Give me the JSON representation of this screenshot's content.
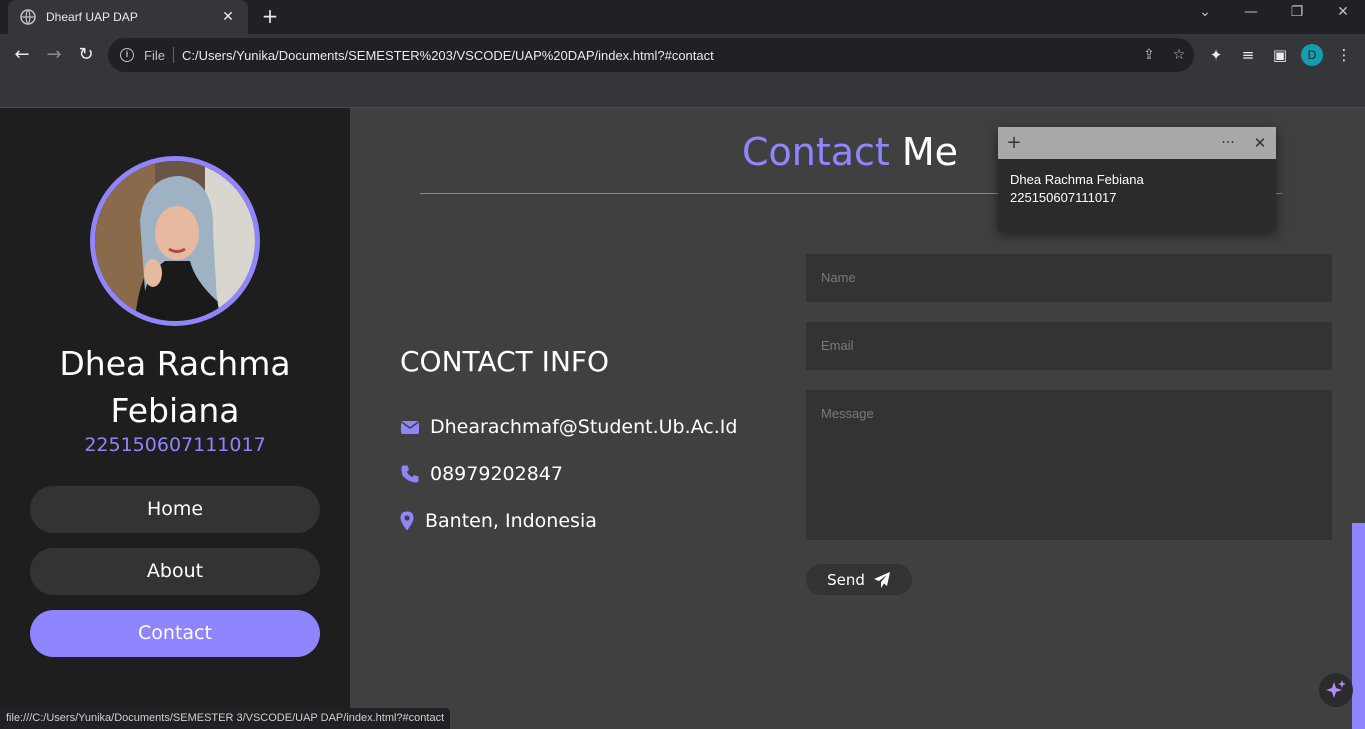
{
  "browser": {
    "tab_title": "Dhearf UAP DAP",
    "new_tab": "+",
    "omnibox_file_label": "File",
    "url": "C:/Users/Yunika/Documents/SEMESTER%203/VSCODE/UAP%20DAP/index.html?#contact",
    "profile_initial": "D",
    "status_url": "file:///C:/Users/Yunika/Documents/SEMESTER 3/VSCODE/UAP DAP/index.html?#contact"
  },
  "sidebar": {
    "name": "Dhea Rachma Febiana",
    "student_id": "225150607111017",
    "nav": [
      {
        "label": "Home"
      },
      {
        "label": "About"
      },
      {
        "label": "Contact"
      }
    ]
  },
  "main": {
    "title_accent": "Contact",
    "title_rest": " Me",
    "contact_heading": "CONTACT INFO",
    "email": "Dhearachmaf@Student.Ub.Ac.Id",
    "phone": "08979202847",
    "location": "Banten, Indonesia"
  },
  "form": {
    "name_placeholder": "Name",
    "email_placeholder": "Email",
    "message_placeholder": "Message",
    "send_label": "Send"
  },
  "note": {
    "line1": "Dhea Rachma Febiana",
    "line2": "225150607111017"
  },
  "colors": {
    "accent": "#8f86ff",
    "sidebar_bg": "#1e1e1e",
    "main_bg": "#404040",
    "field_bg": "#333333"
  }
}
